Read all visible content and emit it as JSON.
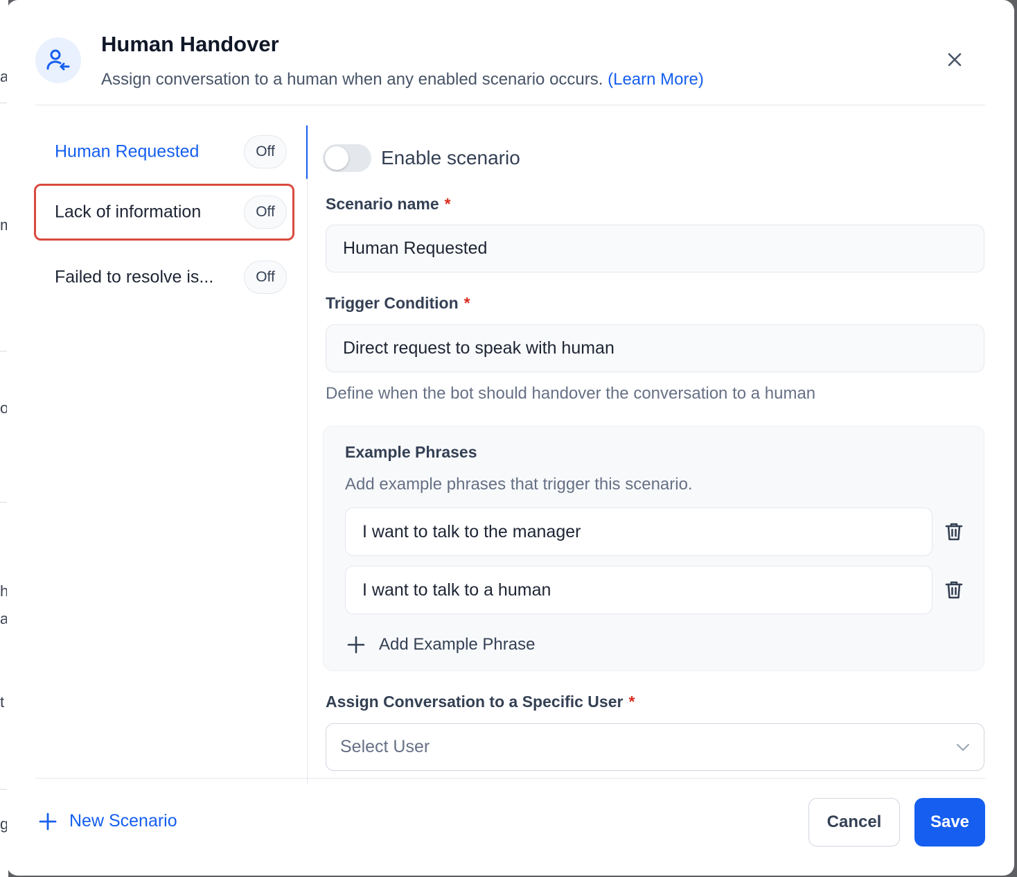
{
  "background": {
    "fragments": [
      "a",
      "m",
      "o",
      "h",
      "a",
      "t",
      "g"
    ]
  },
  "modal": {
    "title": "Human Handover",
    "subtitle": "Assign conversation to a human when any enabled scenario occurs.",
    "learn_more": "(Learn More)",
    "header_icon": "user-handover-icon",
    "close_icon": "close-icon"
  },
  "scenarios": [
    {
      "label": "Human Requested",
      "status": "Off",
      "active": true
    },
    {
      "label": "Lack of information",
      "status": "Off",
      "highlighted": true
    },
    {
      "label": "Failed to resolve is...",
      "status": "Off"
    }
  ],
  "detail": {
    "enable_label": "Enable scenario",
    "enabled": false,
    "scenario_name_label": "Scenario name",
    "scenario_name_value": "Human Requested",
    "trigger_label": "Trigger Condition",
    "trigger_value": "Direct request to speak with human",
    "trigger_helper": "Define when the bot should handover the conversation to a human",
    "required_mark": "*",
    "examples": {
      "title": "Example Phrases",
      "subtitle": "Add example phrases that trigger this scenario.",
      "phrases": [
        "I want to talk to the manager",
        "I want to talk to a human"
      ],
      "add_label": "Add Example Phrase"
    },
    "assign_label": "Assign Conversation to a Specific User",
    "assign_placeholder": "Select User"
  },
  "footer": {
    "new_scenario": "New Scenario",
    "cancel": "Cancel",
    "save": "Save"
  },
  "colors": {
    "accent": "#155eef",
    "highlight_border": "#d9493d",
    "required": "#d92d20"
  }
}
